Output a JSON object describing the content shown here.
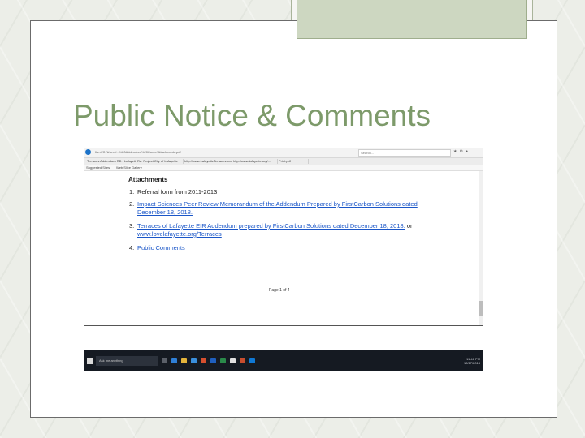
{
  "slide": {
    "title": "Public Notice & Comments"
  },
  "browser": {
    "url": "file:///C:/Users/...%20Addendum%20Cover/Attachments.pdf",
    "search_placeholder": "Search...",
    "tabs": [
      "Terraces Addendum RD - Lafayette",
      "Re: Project City of Lafayette",
      "http://www.LafayetteTerraces.com",
      "http://www.lafayette.org/...",
      "Print.pdf"
    ],
    "favorites": [
      "Suggested Sites",
      "Web Slice Gallery"
    ]
  },
  "document": {
    "heading": "Attachments",
    "items": [
      {
        "num": "1.",
        "text": "Referral form from 2011-2013",
        "link": false
      },
      {
        "num": "2.",
        "text": "Impact Sciences Peer Review Memorandum of the Addendum Prepared by FirstCarbon Solutions dated December 18, 2018.",
        "link": true
      },
      {
        "num": "3.",
        "text_link": "Terraces of Lafayette EIR Addendum prepared by FirstCarbon Solutions dated December 18, 2018.",
        "text_or": "or",
        "text_link2": "www.lovelafayette.org/Terraces",
        "link": true
      },
      {
        "num": "4.",
        "text": "Public Comments",
        "link": true
      }
    ],
    "page_indicator": "Page 1 of 4"
  },
  "taskbar": {
    "search_placeholder": "Ask me anything",
    "time": "11:46 PM",
    "date": "12/27/2018"
  },
  "colors": {
    "title": "#7d9a6a",
    "link": "#1a56c8",
    "taskbar": "#151a22"
  }
}
